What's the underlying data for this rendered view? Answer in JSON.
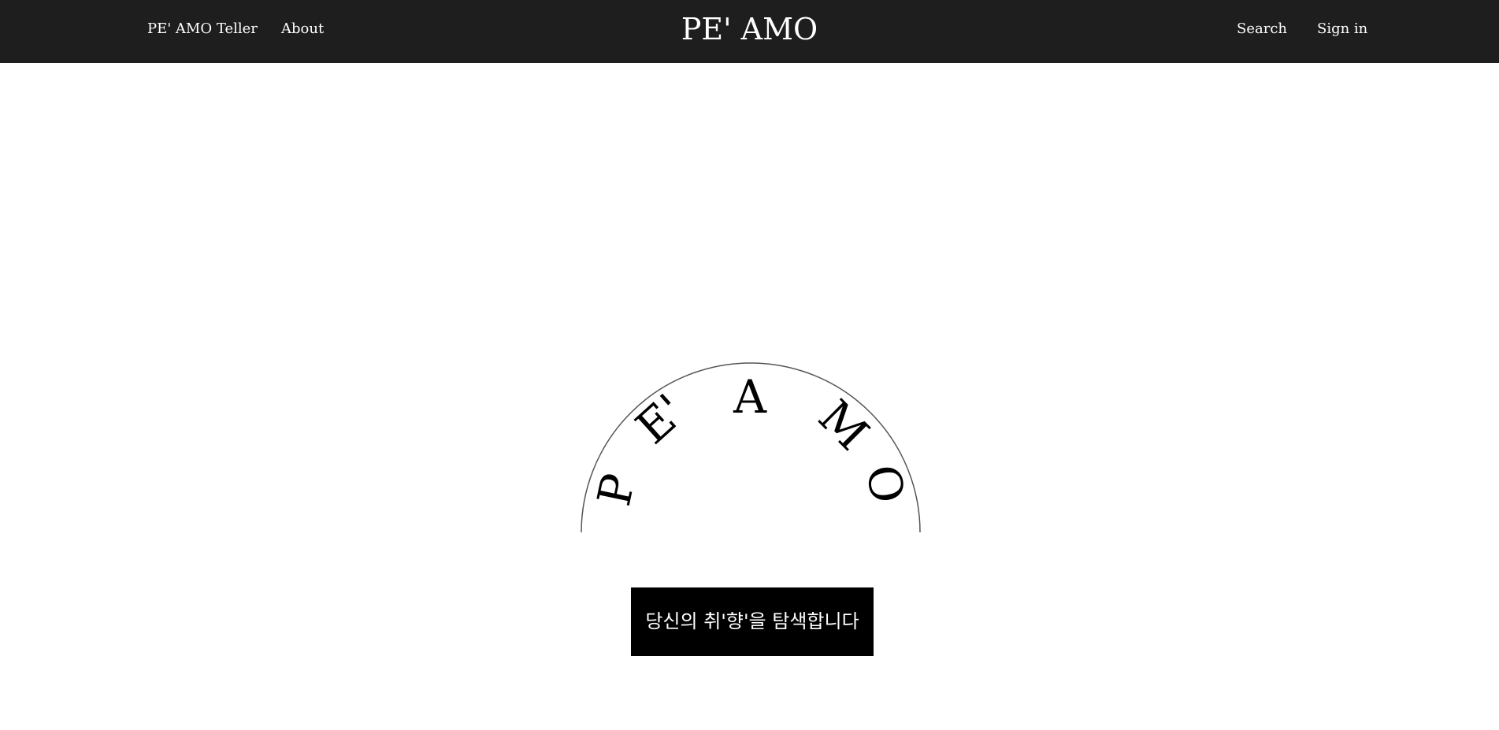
{
  "nav": {
    "left_links": [
      "PE' AMO Teller",
      "About"
    ],
    "brand": "PE' AMO",
    "right_links": [
      "Search",
      "Sign in"
    ],
    "background": "#1e1e1e",
    "text_color": "#ffffff"
  },
  "hero": {
    "logo_letters": [
      "P",
      "E'",
      "A",
      "M",
      "O"
    ],
    "cta_label": "당신의 취'향'을 탐색합니다",
    "cta_background": "#000000",
    "cta_text_color": "#ffffff"
  }
}
